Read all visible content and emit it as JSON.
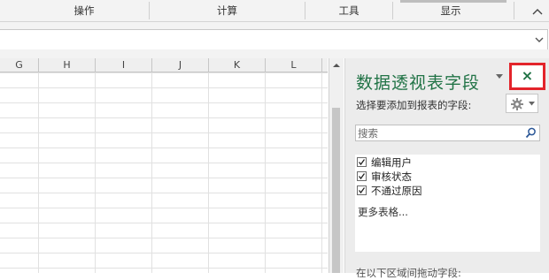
{
  "ribbon": {
    "groups": [
      "操作",
      "计算",
      "工具",
      "显示"
    ]
  },
  "grid": {
    "columns": [
      "G",
      "H",
      "I",
      "J",
      "K",
      "L"
    ]
  },
  "pane": {
    "title": "数据透视表字段",
    "close_glyph": "×",
    "subtitle": "选择要添加到报表的字段:",
    "search_placeholder": "搜索",
    "fields": [
      {
        "label": "编辑用户",
        "checked": true
      },
      {
        "label": "审核状态",
        "checked": true
      },
      {
        "label": "不通过原因",
        "checked": true
      }
    ],
    "more_tables": "更多表格...",
    "bottom_hint": "在以下区域间拖动字段:"
  },
  "colors": {
    "accent": "#217346",
    "highlight_box": "#e3242b"
  },
  "icons": [
    "chevron-up-icon",
    "dropdown-arrow-icon",
    "scroll-up-icon",
    "dropdown-arrow-icon",
    "close-icon",
    "gear-icon",
    "search-icon",
    "checkbox-checked-icon"
  ]
}
